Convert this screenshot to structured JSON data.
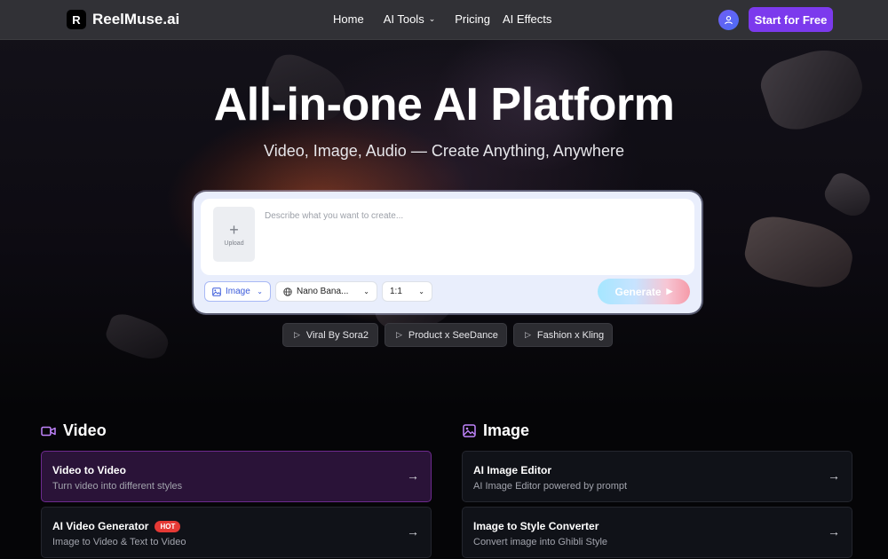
{
  "nav": {
    "logo_mark": "R",
    "brand": "ReelMuse.ai",
    "links": [
      "Home",
      "AI Tools",
      "Pricing",
      "AI Effects"
    ],
    "start_label": "Start for Free"
  },
  "hero": {
    "title": "All-in-one AI Platform",
    "subtitle": "Video, Image, Audio — Create Anything, Anywhere"
  },
  "prompt": {
    "upload_label": "Upload",
    "placeholder": "Describe what you want to create...",
    "type_select": "Image",
    "model_select": "Nano Bana...",
    "ratio_select": "1:1",
    "generate_label": "Generate"
  },
  "chips": [
    "Viral By Sora2",
    "Product x SeeDance",
    "Fashion x Kling"
  ],
  "sections": {
    "video": {
      "title": "Video",
      "items": [
        {
          "name": "Video to Video",
          "desc": "Turn video into different styles"
        },
        {
          "name": "AI Video Generator",
          "badge": "HOT",
          "desc": "Image to Video & Text to Video"
        }
      ]
    },
    "image": {
      "title": "Image",
      "items": [
        {
          "name": "AI Image Editor",
          "desc": "AI Image Editor powered by prompt"
        },
        {
          "name": "Image to Style Converter",
          "desc": "Convert image into Ghibli Style"
        }
      ]
    }
  },
  "colors": {
    "accent": "#7c3aed",
    "hot": "#e53935",
    "active_card": "#2a1338",
    "section_icon": "#c084fc"
  },
  "icons": {
    "avatar": "user-icon",
    "type_select": "image-icon",
    "model_select": "globe-icon",
    "chip": "play-icon",
    "video_section": "video-camera-icon",
    "image_section": "image-icon",
    "card_arrow": "arrow-right-icon"
  }
}
